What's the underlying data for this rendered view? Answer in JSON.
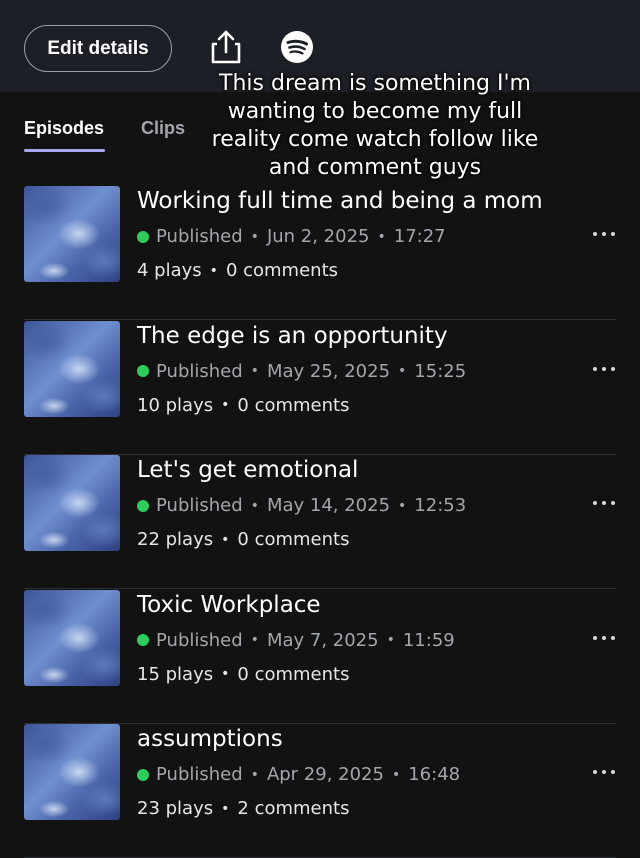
{
  "header": {
    "edit_label": "Edit details",
    "share_icon": "share-icon",
    "spotify_icon": "spotify-icon"
  },
  "tabs": [
    {
      "label": "Episodes",
      "active": true
    },
    {
      "label": "Clips",
      "active": false
    }
  ],
  "caption": "This dream is something I'm wanting to become my full reality come watch follow like and comment guys",
  "colors": {
    "background": "#121212",
    "header": "#1c1f25",
    "accent_underline": "#a9a8f2",
    "published_dot": "#2ecc5b"
  },
  "episodes": [
    {
      "title": "Working full time and being a mom",
      "status": "Published",
      "date": "Jun 2, 2025",
      "duration": "17:27",
      "plays": "4 plays",
      "comments": "0 comments"
    },
    {
      "title": "The edge is an opportunity",
      "status": "Published",
      "date": "May 25, 2025",
      "duration": "15:25",
      "plays": "10 plays",
      "comments": "0 comments"
    },
    {
      "title": "Let's get emotional",
      "status": "Published",
      "date": "May 14, 2025",
      "duration": "12:53",
      "plays": "22 plays",
      "comments": "0 comments"
    },
    {
      "title": "Toxic Workplace",
      "status": "Published",
      "date": "May 7, 2025",
      "duration": "11:59",
      "plays": "15 plays",
      "comments": "0 comments"
    },
    {
      "title": "assumptions",
      "status": "Published",
      "date": "Apr 29, 2025",
      "duration": "16:48",
      "plays": "23 plays",
      "comments": "2 comments"
    }
  ]
}
